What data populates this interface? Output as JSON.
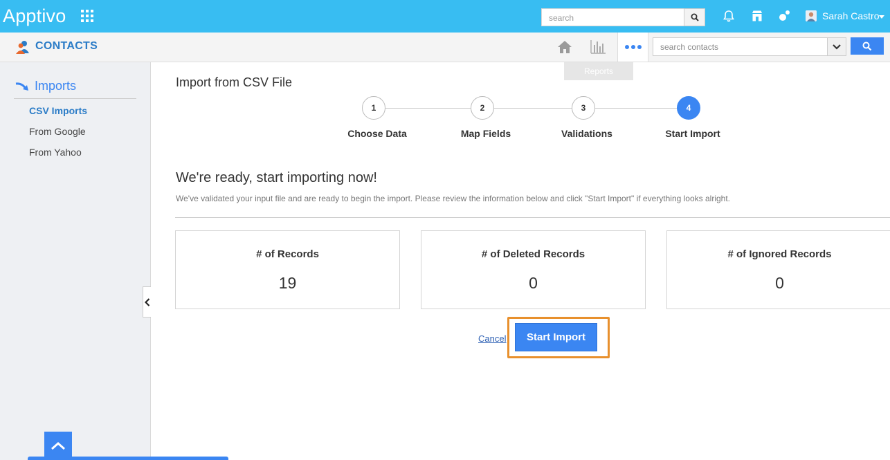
{
  "header": {
    "logo": "Apptivo",
    "search_placeholder": "search",
    "user_name": "Sarah Castro"
  },
  "subheader": {
    "app_title": "CONTACTS",
    "contact_search_placeholder": "search contacts",
    "tooltip": "Reports"
  },
  "sidebar": {
    "heading": "Imports",
    "items": [
      {
        "label": "CSV Imports",
        "active": true
      },
      {
        "label": "From Google",
        "active": false
      },
      {
        "label": "From Yahoo",
        "active": false
      }
    ]
  },
  "main": {
    "title": "Import from CSV File",
    "steps": [
      {
        "number": "1",
        "label": "Choose Data"
      },
      {
        "number": "2",
        "label": "Map Fields"
      },
      {
        "number": "3",
        "label": "Validations"
      },
      {
        "number": "4",
        "label": "Start Import"
      }
    ],
    "active_step": 4,
    "ready_title": "We're ready, start importing now!",
    "ready_description": "We've validated your input file and are ready to begin the import. Please review the information below and click \"Start Import\" if everything looks alright.",
    "stats": [
      {
        "label": "# of Records",
        "value": "19"
      },
      {
        "label": "# of Deleted Records",
        "value": "0"
      },
      {
        "label": "# of Ignored Records",
        "value": "0"
      }
    ],
    "cancel_label": "Cancel",
    "start_label": "Start Import"
  },
  "colors": {
    "topbar": "#38bdf2",
    "accent": "#3b86f2",
    "highlight": "#e8902d"
  }
}
